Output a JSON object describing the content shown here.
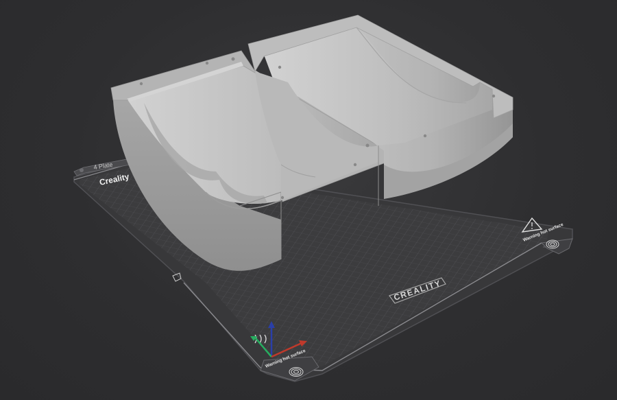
{
  "viewport": {
    "background_color": "#2e2e30",
    "plate_tab_label": "4 Plate",
    "plate_brand_text": "Creality",
    "center_logo_text": "CREALITY",
    "warning_text_left": "Warning hot surface",
    "warning_text_right": "Warning hot surface",
    "model_color": "#b8b8b8",
    "bed_color": "#3c3c3e"
  },
  "axes": {
    "x_color": "#c0392b",
    "y_color": "#27ae60",
    "z_color": "#2a3fa8"
  },
  "icons": [
    "fingerprint-icon",
    "warning-triangle-icon",
    "hot-surface-icon",
    "alignment-marker-icon"
  ]
}
